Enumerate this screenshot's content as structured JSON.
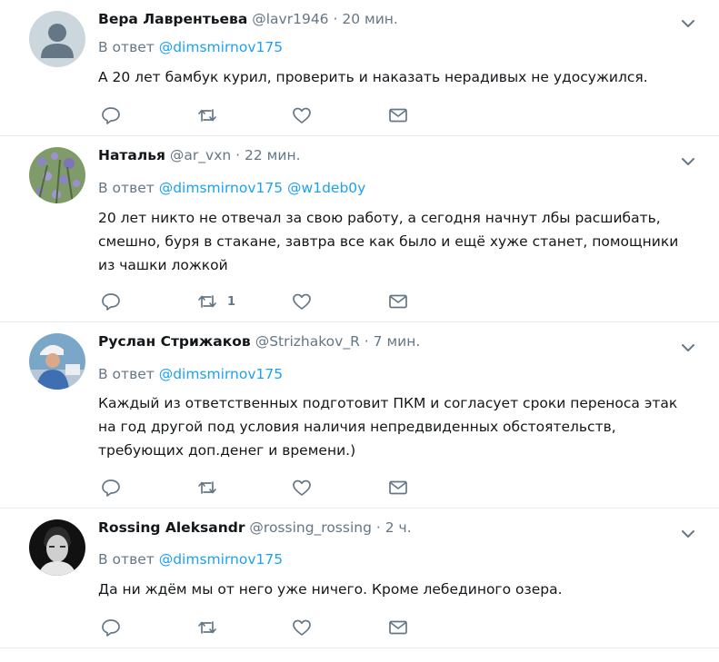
{
  "reply_prefix": "В ответ",
  "tweets": [
    {
      "name": "Вера Лаврентьева",
      "handle": "@lavr1946",
      "separator": "·",
      "time": "20 мин.",
      "reply_to": [
        "@dimsmirnov175"
      ],
      "text": "А 20 лет бамбук курил, проверить  и наказать нерадивых не удосужился.",
      "retweet_count": ""
    },
    {
      "name": "Наталья",
      "handle": "@ar_vxn",
      "separator": "·",
      "time": "22 мин.",
      "reply_to": [
        "@dimsmirnov175",
        "@w1deb0y"
      ],
      "text": "20 лет никто не отвечал за свою работу, а сегодня начнут лбы расшибать, смешно, буря в стакане, завтра все как было и ещё хуже станет, помощники из чашки ложкой",
      "retweet_count": "1"
    },
    {
      "name": "Руслан Стрижаков",
      "handle": "@Strizhakov_R",
      "separator": "·",
      "time": "7 мин.",
      "reply_to": [
        "@dimsmirnov175"
      ],
      "text": "Каждый из ответственных подготовит ПКМ  и согласует сроки переноса этак на год другой под условия наличия непредвиденных обстоятельств, требующих доп.денег и времени.)",
      "retweet_count": ""
    },
    {
      "name": "Rossing Aleksandr",
      "handle": "@rossing_rossing",
      "separator": "·",
      "time": "2 ч.",
      "reply_to": [
        "@dimsmirnov175"
      ],
      "text": "Да ни ждём мы от него уже ничего. Кроме лебединого озера.",
      "retweet_count": ""
    }
  ],
  "icons": {
    "reply": "reply-icon",
    "retweet": "retweet-icon",
    "like": "like-icon",
    "dm": "direct-message-icon",
    "more": "chevron-down-icon"
  },
  "colors": {
    "name": "#14171a",
    "meta": "#657786",
    "mention": "#1da1f2",
    "divider": "#e6ecf0"
  }
}
